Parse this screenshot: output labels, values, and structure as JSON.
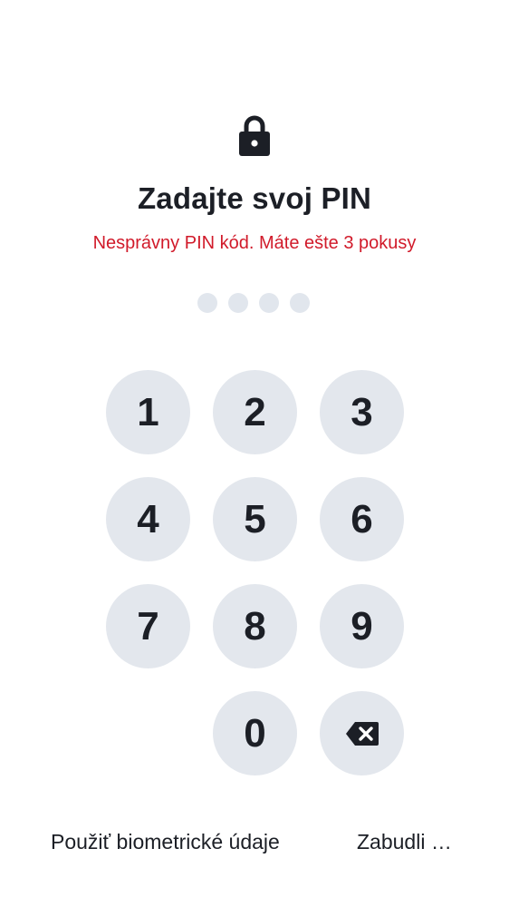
{
  "header": {
    "lock_icon": "lock-icon",
    "title": "Zadajte svoj PIN",
    "error_message": "Nesprávny PIN kód. Máte ešte 3 pokusy",
    "error_color": "#d11a2a"
  },
  "pin": {
    "length": 4,
    "filled": 0
  },
  "keypad": {
    "keys": [
      "1",
      "2",
      "3",
      "4",
      "5",
      "6",
      "7",
      "8",
      "9",
      "0"
    ],
    "backspace_icon": "backspace-icon"
  },
  "footer": {
    "biometric_label": "Použiť biometrické údaje",
    "forgot_label": "Zabudli …"
  }
}
